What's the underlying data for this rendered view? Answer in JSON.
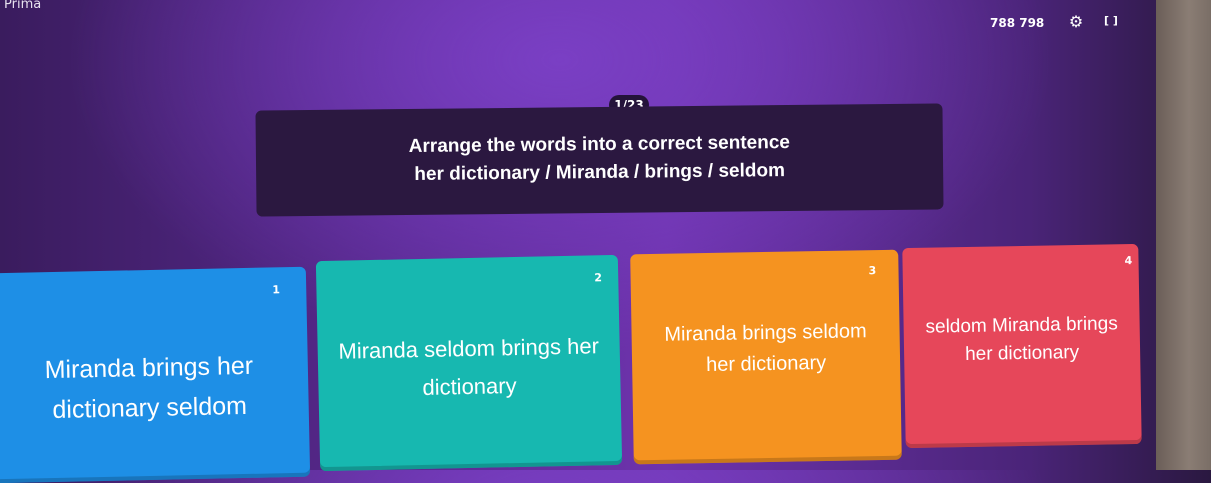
{
  "app": {
    "title": "Prima"
  },
  "header": {
    "score": "788  798",
    "fullscreen_label": "[ ]"
  },
  "question": {
    "counter": "1/23",
    "instruction": "Arrange the words into a correct sentence",
    "words": "her dictionary / Miranda / brings / seldom"
  },
  "answers": [
    {
      "number": "1",
      "text": "Miranda brings her dictionary seldom",
      "color": "#1e8fe6"
    },
    {
      "number": "2",
      "text": "Miranda seldom brings her dictionary",
      "color": "#17b8b0"
    },
    {
      "number": "3",
      "text": "Miranda brings seldom her dictionary",
      "color": "#f59320"
    },
    {
      "number": "4",
      "text": "seldom Miranda brings her dictionary",
      "color": "#e6475a"
    }
  ]
}
